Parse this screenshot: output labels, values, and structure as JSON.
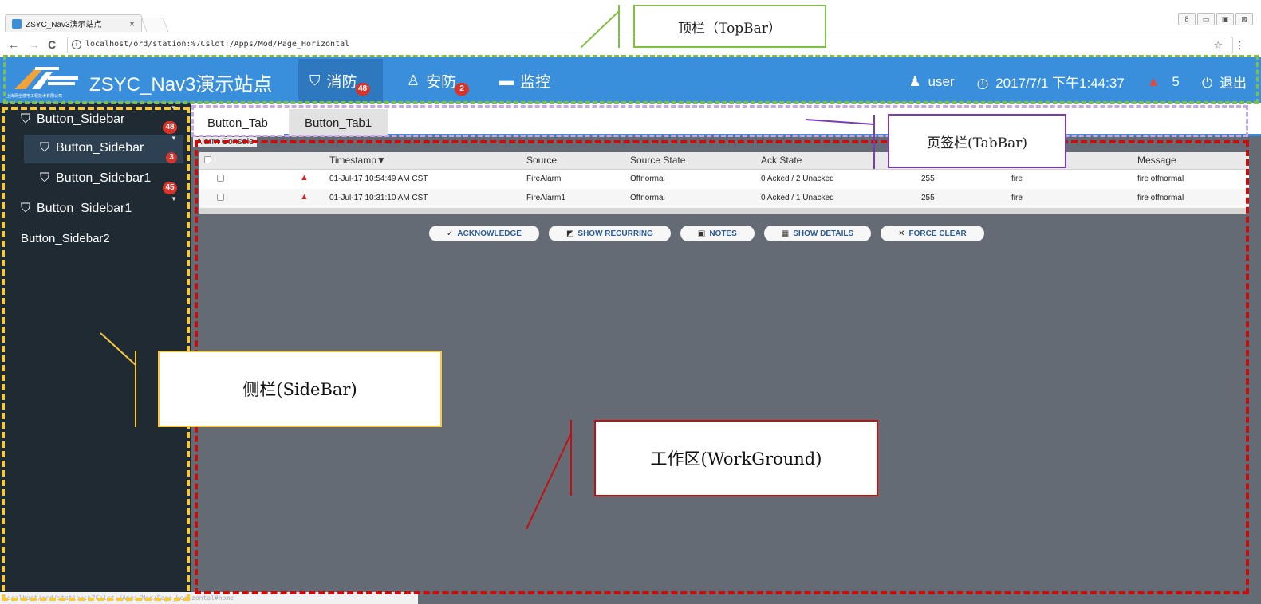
{
  "browser": {
    "tab_title": "ZSYC_Nav3演示站点",
    "tab_close": "×",
    "url": "localhost/ord/station:%7Cslot:/Apps/Mod/Page_Horizontal",
    "status_url": "localhost/ord/station:%7Cslot:/Apps/Mod/Page_Horizontal#home",
    "back": "←",
    "forward": "→",
    "reload": "C",
    "star": "☆",
    "menu": "⋮",
    "win_buttons": [
      "8",
      "▭",
      "▣",
      "⊠"
    ]
  },
  "topbar": {
    "logo_text": "上海研全楼电工程技术有限公司",
    "app_title": "ZSYC_Nav3演示站点",
    "nav": [
      {
        "icon": "fire-extinguisher-icon",
        "glyph": "⛉",
        "label": "消防",
        "badge": "48",
        "active": true
      },
      {
        "icon": "person-icon",
        "glyph": "♙",
        "label": "安防",
        "badge": "2",
        "active": false
      },
      {
        "icon": "camera-icon",
        "glyph": "▬",
        "label": "监控",
        "badge": "",
        "active": false
      }
    ],
    "user_icon": "♟",
    "user": "user",
    "clock_icon": "◷",
    "datetime": "2017/7/1 下午1:44:37",
    "alarm_icon": "▲",
    "alarm_count": "5",
    "logout_icon": "⏻",
    "logout": "退出"
  },
  "sidebar": {
    "icon_glyph": "⛉",
    "items": [
      {
        "label": "Button_Sidebar",
        "badge": "48"
      },
      {
        "label": "Button_Sidebar",
        "badge": "3"
      },
      {
        "label": "Button_Sidebar1",
        "badge": "45"
      },
      {
        "label": "Button_Sidebar1",
        "badge": ""
      },
      {
        "label": "Button_Sidebar2",
        "badge": ""
      }
    ]
  },
  "tabbar": {
    "tabs": [
      {
        "label": "Button_Tab",
        "active": true
      },
      {
        "label": "Button_Tab1",
        "active": false
      }
    ]
  },
  "work": {
    "console_label": "Alarm Console",
    "columns": [
      "Timestamp▼",
      "Source",
      "Source State",
      "Ack State",
      "Message"
    ],
    "rows": [
      {
        "timestamp": "01-Jul-17 10:54:49 AM CST",
        "source": "FireAlarm",
        "state": "Offnormal",
        "ack": "0 Acked / 2 Unacked",
        "priority": "255",
        "class": "fire",
        "message": "fire offnormal"
      },
      {
        "timestamp": "01-Jul-17 10:31:10 AM CST",
        "source": "FireAlarm1",
        "state": "Offnormal",
        "ack": "0 Acked / 1 Unacked",
        "priority": "255",
        "class": "fire",
        "message": "fire offnormal"
      }
    ],
    "actions": [
      {
        "icon": "acknowledge-icon",
        "glyph": "✓",
        "label": "ACKNOWLEDGE"
      },
      {
        "icon": "recurring-icon",
        "glyph": "◩",
        "label": "SHOW RECURRING"
      },
      {
        "icon": "notes-icon",
        "glyph": "▣",
        "label": "NOTES"
      },
      {
        "icon": "details-icon",
        "glyph": "▦",
        "label": "SHOW DETAILS"
      },
      {
        "icon": "force-clear-icon",
        "glyph": "✕",
        "label": "FORCE CLEAR"
      }
    ]
  },
  "annotations": {
    "topbar": "顶栏（TopBar）",
    "tabbar": "页签栏(TabBar)",
    "sidebar": "侧栏(SideBar)",
    "workground": "工作区(WorkGround)"
  },
  "colors": {
    "topbar": "#3a8fdd",
    "sidebar": "#1f2a33",
    "work": "#646b74",
    "badge": "#d9342b",
    "topbar_outline": "#7ec142",
    "tabbar_outline": "#c8a8e0",
    "sidebar_outline": "#f5c842",
    "work_outline": "#c40f0f"
  }
}
